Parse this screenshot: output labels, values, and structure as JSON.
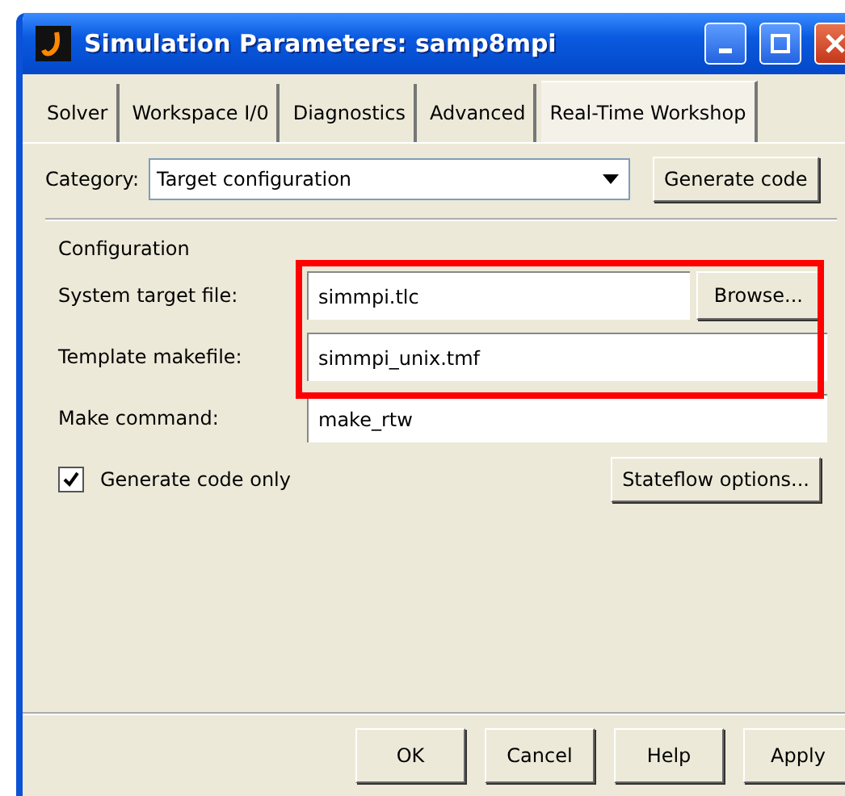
{
  "window": {
    "title": "Simulation Parameters: samp8mpi"
  },
  "tabs": [
    {
      "label": "Solver",
      "selected": false
    },
    {
      "label": "Workspace I/0",
      "selected": false
    },
    {
      "label": "Diagnostics",
      "selected": false
    },
    {
      "label": "Advanced",
      "selected": false
    },
    {
      "label": "Real-Time Workshop",
      "selected": true
    }
  ],
  "category": {
    "label": "Category:",
    "value": "Target configuration",
    "button": "Generate code"
  },
  "configuration": {
    "heading": "Configuration",
    "highlight": true,
    "fields": [
      {
        "label": "System target file:",
        "value": "simmpi.tlc",
        "button": "Browse..."
      },
      {
        "label": "Template makefile:",
        "value": "simmpi_unix.tmf"
      },
      {
        "label": "Make command:",
        "value": "make_rtw"
      }
    ],
    "checkbox": {
      "label": "Generate code only",
      "checked": true
    },
    "options_button": "Stateflow options..."
  },
  "buttons": [
    "OK",
    "Cancel",
    "Help",
    "Apply"
  ]
}
